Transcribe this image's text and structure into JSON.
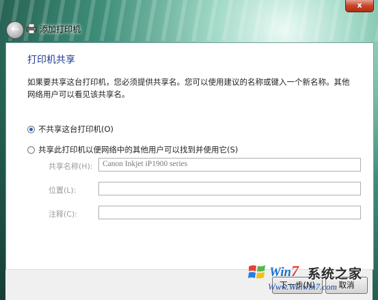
{
  "window": {
    "title": "添加打印机",
    "close_label": "x"
  },
  "page": {
    "heading": "打印机共享",
    "description": "如果要共享这台打印机，您必须提供共享名。您可以使用建议的名称或键入一个新名称。其他网络用户可以看见该共享名。"
  },
  "options": {
    "no_share_label": "不共享这台打印机(O)",
    "share_label": "共享此打印机以便网络中的其他用户可以找到并使用它(S)",
    "selected": "no_share"
  },
  "fields": {
    "share_name_label": "共享名称(H):",
    "share_name_value": "Canon Inkjet iP1900 series",
    "location_label": "位置(L):",
    "location_value": "",
    "comment_label": "注释(C):",
    "comment_value": ""
  },
  "buttons": {
    "next_label": "下一步(N)",
    "cancel_label": "取消"
  },
  "watermark": {
    "brand_prefix": "Win",
    "brand_seven": "7",
    "brand_cn": "系统之家",
    "url": "Www.Winwin7.com"
  },
  "colors": {
    "heading": "#1f3a93",
    "close_button": "#c7452b",
    "radio_selected": "#2f5fae"
  },
  "icons": {
    "back": "back-arrow-icon",
    "title": "printer-icon",
    "close": "close-icon",
    "logo": "windows-flag-icon"
  }
}
